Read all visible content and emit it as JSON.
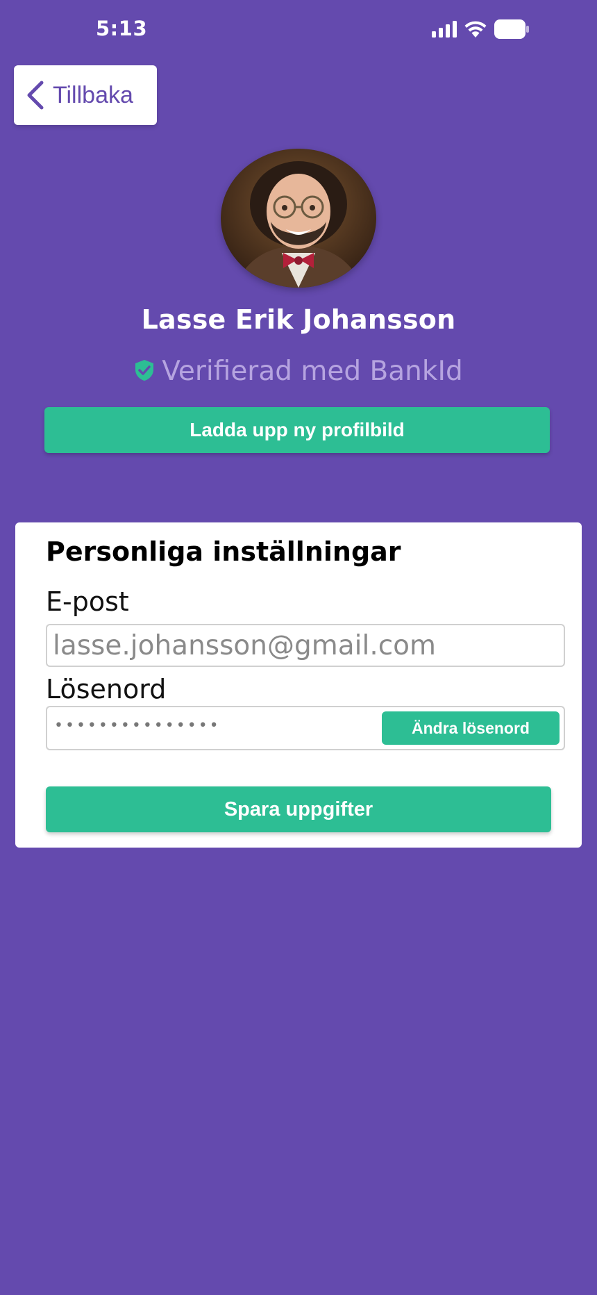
{
  "status_bar": {
    "time": "5:13",
    "icons": [
      "signal-icon",
      "wifi-icon",
      "battery-icon"
    ]
  },
  "nav": {
    "back_label": "Tillbaka",
    "back_icon": "chevron-left-icon"
  },
  "profile": {
    "name": "Lasse Erik Johansson",
    "verified_text": "Verifierad med BankId",
    "verified_icon": "shield-check-icon",
    "upload_button_label": "Ladda upp ny profilbild"
  },
  "settings": {
    "title": "Personliga inställningar",
    "email_label": "E-post",
    "email_value": "lasse.johansson@gmail.com",
    "password_label": "Lösenord",
    "password_masked": "•••••••••••••••",
    "change_password_label": "Ändra lösenord",
    "save_button_label": "Spara uppgifter"
  },
  "colors": {
    "background": "#644aae",
    "accent": "#2dbe94",
    "verified_text": "#b6a4e0",
    "card": "#ffffff"
  }
}
